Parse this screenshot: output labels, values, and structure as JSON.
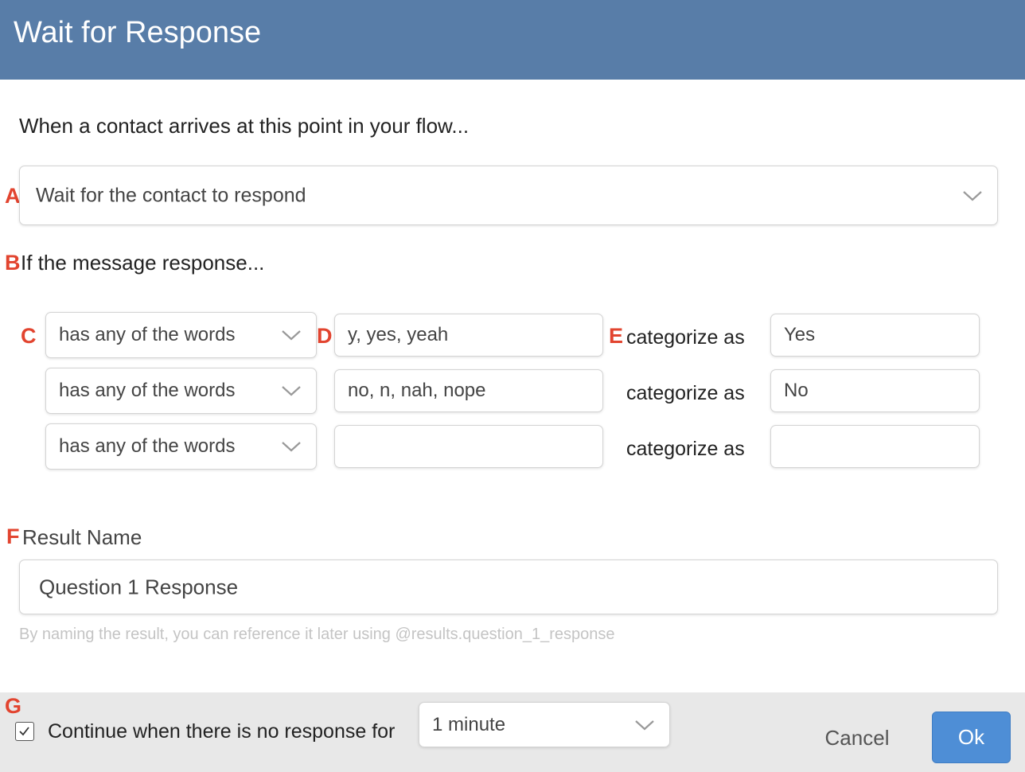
{
  "header": {
    "title": "Wait for Response"
  },
  "markers": {
    "a": "A",
    "b": "B",
    "c": "C",
    "d": "D",
    "e": "E",
    "f": "F",
    "g": "G"
  },
  "intro": "When a contact arrives at this point in your flow...",
  "wait_select": {
    "value": "Wait for the contact to respond"
  },
  "rules_heading": "If the message response...",
  "rules": [
    {
      "operator": "has any of the words",
      "arguments": "y, yes, yeah",
      "categorize_label": "categorize as",
      "category": "Yes"
    },
    {
      "operator": "has any of the words",
      "arguments": "no, n, nah, nope",
      "categorize_label": "categorize as",
      "category": "No"
    },
    {
      "operator": "has any of the words",
      "arguments": "",
      "categorize_label": "categorize as",
      "category": ""
    }
  ],
  "result": {
    "label": "Result Name",
    "value": "Question 1 Response",
    "help": "By naming the result, you can reference it later using @results.question_1_response"
  },
  "footer": {
    "continue_checked": true,
    "continue_label": "Continue when there is no response for",
    "timeout_value": "1 minute",
    "cancel_label": "Cancel",
    "ok_label": "Ok"
  },
  "colors": {
    "header": "#587da8",
    "marker": "#e2442f",
    "ok_button": "#4e8ed6",
    "footer": "#e8e8e8"
  },
  "icons": {
    "select_arrow": "chevron-down-icon",
    "checkbox": "checkmark-icon"
  }
}
